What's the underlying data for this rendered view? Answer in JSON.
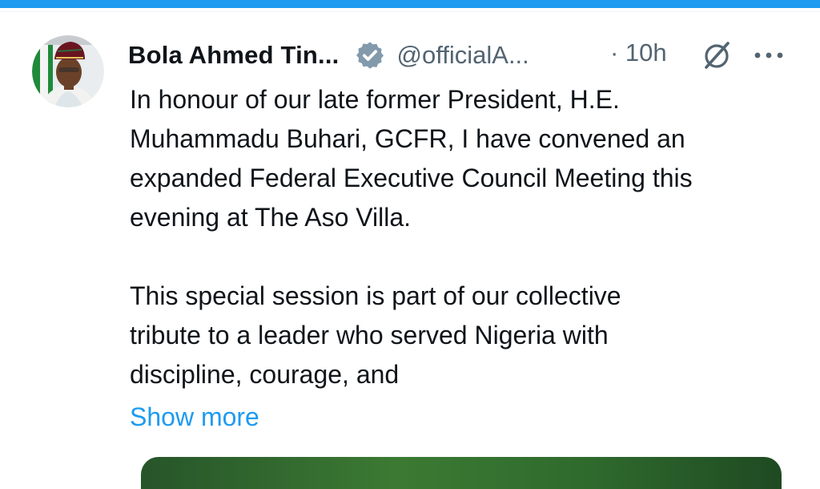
{
  "tweet": {
    "author_name": "Bola Ahmed Tin...",
    "verified_icon": "verified-badge-icon",
    "handle": "@officialA...",
    "time": "· 10h",
    "grok_icon": "grok-slash-icon",
    "more_icon": "more-dots-icon",
    "paragraphs": [
      [
        "In honour of our late former President, H.E.",
        "Muhammadu Buhari, GCFR, I have convened an",
        "expanded Federal Executive Council Meeting this",
        "evening at The Aso Villa."
      ],
      [
        "This special session is part of our collective",
        "tribute to a leader who served Nigeria with",
        "discipline, courage, and"
      ]
    ],
    "show_more": "Show more"
  },
  "colors": {
    "accent": "#1d9bf0",
    "text": "#0f1419",
    "muted": "#536471"
  }
}
